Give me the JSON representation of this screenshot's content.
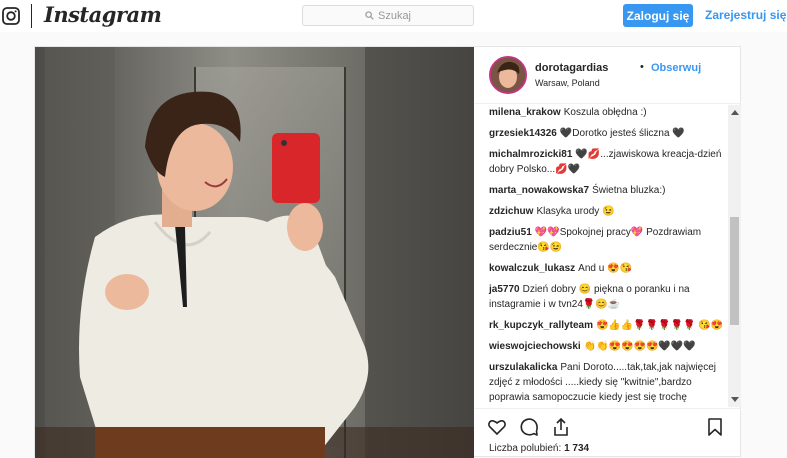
{
  "topbar": {
    "logo_text": "Instagram",
    "search_placeholder": "Szukaj",
    "login_label": "Zaloguj się",
    "register_label": "Zarejestruj się"
  },
  "post": {
    "username": "dorotagardias",
    "separator": "•",
    "follow_label": "Obserwuj",
    "location": "Warsaw, Poland",
    "likes_label": "Liczba polubień:",
    "likes_count": "1 734"
  },
  "comments": [
    {
      "user": "milena_krakow",
      "text": "Koszula obłędna :)"
    },
    {
      "user": "grzesiek14326",
      "text": "🖤Dorotko jesteś śliczna 🖤"
    },
    {
      "user": "michalmrozicki81",
      "text": "🖤💋...zjawiskowa kreacja-dzień dobry Polsko...💋🖤"
    },
    {
      "user": "marta_nowakowska7",
      "text": "Świetna bluzka:)"
    },
    {
      "user": "zdzichuw",
      "text": "Klasyka urody 😉"
    },
    {
      "user": "padziu51",
      "text": "💖💖Spokojnej pracy💖 Pozdrawiam serdecznie😘😉"
    },
    {
      "user": "kowalczuk_lukasz",
      "text": "And u 😍😘"
    },
    {
      "user": "ja5770",
      "text": "Dzień dobry 😊 piękna o poranku i na instagramie i w tvn24🌹😊☕"
    },
    {
      "user": "rk_kupczyk_rallyteam",
      "text": "😍👍👍🌹🌹🌹🌹🌹 😘😍"
    },
    {
      "user": "wieswojciechowski",
      "text": "👏👏😍😍😍😍🖤🖤🖤"
    },
    {
      "user": "urszulakalicka",
      "text": "Pani Doroto.....tak,tak,jak najwięcej zdjęć z młodości .....kiedy się \"kwitnie\",bardzo poprawia samopoczucie kiedy jest się trochę \"starszym\" tak jak ja"
    }
  ],
  "icons": [
    "instagram-camera-icon",
    "search-icon",
    "heart-icon",
    "comment-icon",
    "share-icon",
    "bookmark-icon"
  ],
  "colors": {
    "accent": "#3897f0",
    "text": "#262626",
    "avatar_ring": "#c13584"
  }
}
